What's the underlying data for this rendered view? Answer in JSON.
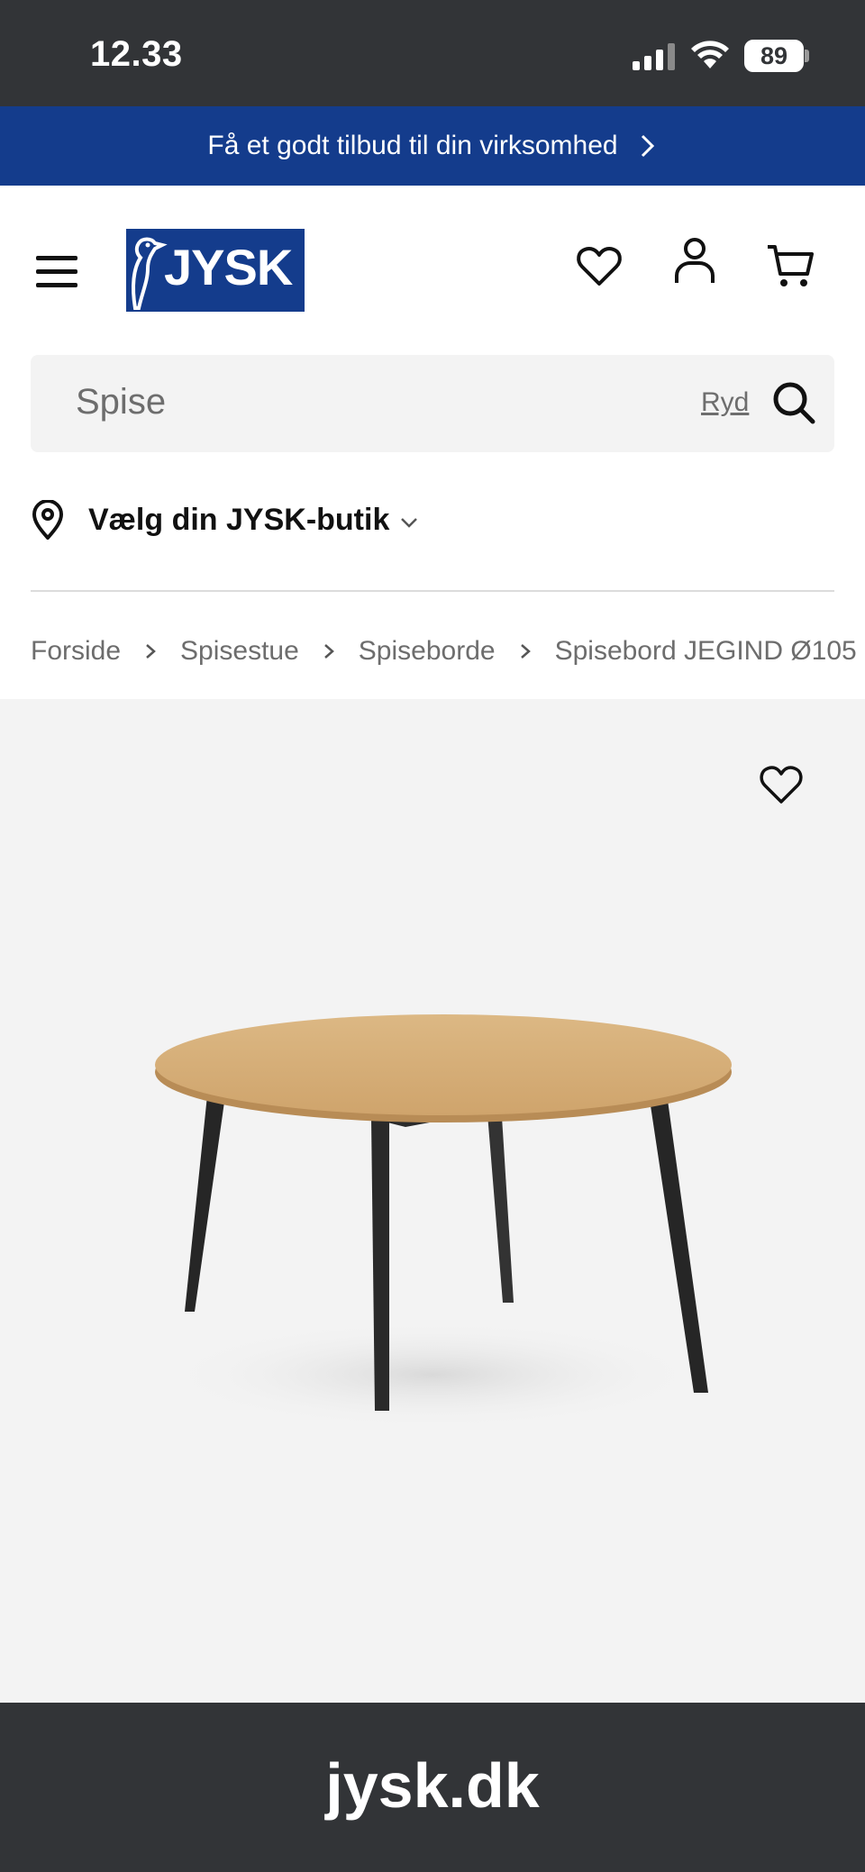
{
  "status_bar": {
    "time": "12.33",
    "battery": "89"
  },
  "promo": {
    "text": "Få et godt tilbud til din virksomhed"
  },
  "header": {
    "logo_text": "JYSK",
    "brand_color": "#143c8c"
  },
  "search": {
    "query": "Spise",
    "clear_label": "Ryd"
  },
  "store_selector": {
    "label": "Vælg din JYSK-butik"
  },
  "breadcrumb": {
    "items": [
      "Forside",
      "Spisestue",
      "Spiseborde",
      "Spisebord JEGIND Ø105"
    ]
  },
  "url_bar": {
    "url": "jysk.dk"
  },
  "colors": {
    "status_bg": "#323437",
    "banner_bg": "#143c8c",
    "search_bg": "#f3f3f3",
    "gallery_bg": "#f3f3f3",
    "table_top": "#d6ad78",
    "table_legs": "#2b2b2b"
  }
}
